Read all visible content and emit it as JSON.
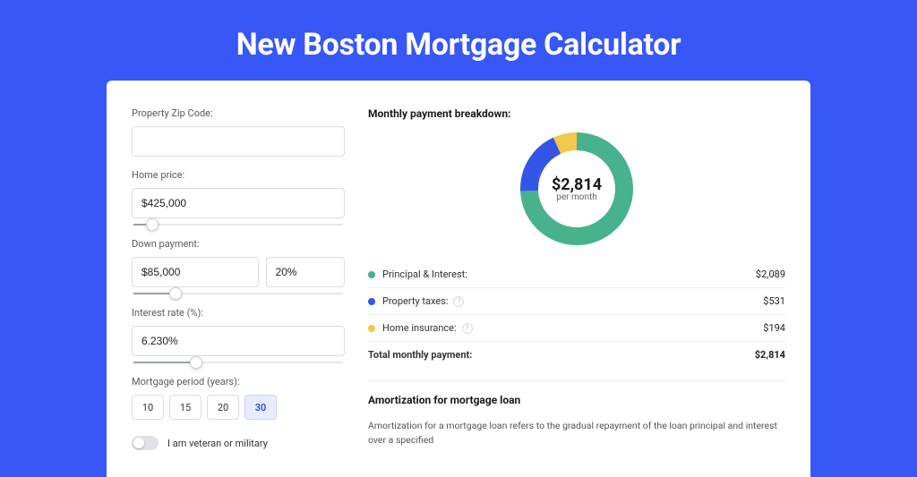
{
  "hero": {
    "title": "New Boston Mortgage Calculator"
  },
  "colors": {
    "pi": "#47b28c",
    "taxes": "#3356e6",
    "ins": "#f2c94c"
  },
  "form": {
    "zip": {
      "label": "Property Zip Code:",
      "value": ""
    },
    "home_price": {
      "label": "Home price:",
      "value": "$425,000",
      "slider_pct": 9
    },
    "down_payment": {
      "label": "Down payment:",
      "value": "$85,000",
      "pct_value": "20%",
      "slider_pct": 20
    },
    "interest_rate": {
      "label": "Interest rate (%):",
      "value": "6.230%",
      "slider_pct": 30
    },
    "periods": {
      "label": "Mortgage period (years):",
      "options": [
        "10",
        "15",
        "20",
        "30"
      ],
      "selected": "30"
    },
    "veteran": {
      "label": "I am veteran or military",
      "on": false
    }
  },
  "breakdown": {
    "title": "Monthly payment breakdown:",
    "center_value": "$2,814",
    "center_sub": "per month",
    "items": [
      {
        "label": "Principal & Interest:",
        "value": "$2,089",
        "color_key": "pi",
        "help": false
      },
      {
        "label": "Property taxes:",
        "value": "$531",
        "color_key": "taxes",
        "help": true
      },
      {
        "label": "Home insurance:",
        "value": "$194",
        "color_key": "ins",
        "help": true
      }
    ],
    "total_label": "Total monthly payment:",
    "total_value": "$2,814"
  },
  "amort": {
    "title": "Amortization for mortgage loan",
    "body": "Amortization for a mortgage loan refers to the gradual repayment of the loan principal and interest over a specified"
  },
  "chart_data": {
    "type": "pie",
    "title": "Monthly payment breakdown",
    "series": [
      {
        "name": "Principal & Interest",
        "value": 2089
      },
      {
        "name": "Property taxes",
        "value": 531
      },
      {
        "name": "Home insurance",
        "value": 194
      }
    ],
    "total": 2814,
    "unit": "$ per month"
  }
}
